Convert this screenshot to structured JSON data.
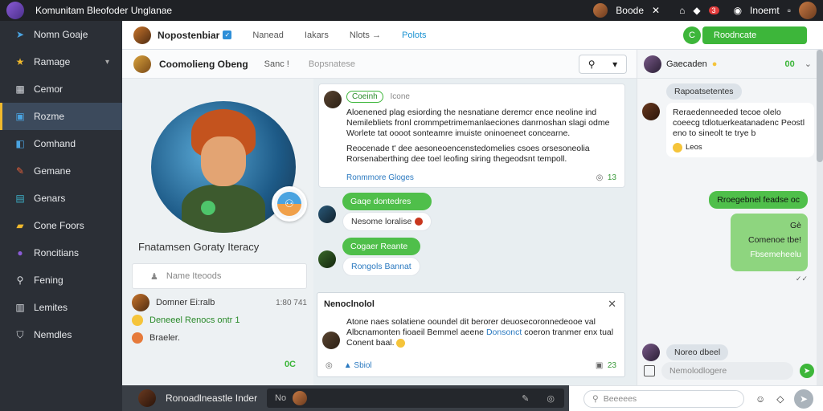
{
  "titlebar": {
    "title": "Komunitam Bleofoder Unglanae",
    "user_name": "Boode",
    "notif_count": "3",
    "account": "Inoemt"
  },
  "sidebar": {
    "items": [
      {
        "label": "Nomn Goaje",
        "icon": "book-icon",
        "color": "#4aa3e0"
      },
      {
        "label": "Ramage",
        "icon": "star-icon",
        "color": "#f0b92d",
        "expandable": true
      },
      {
        "label": "Cemor",
        "icon": "grid-icon",
        "color": "#d8dbe0"
      },
      {
        "label": "Rozme",
        "icon": "square-icon",
        "color": "#4aa3e0",
        "active": true
      },
      {
        "label": "Comhand",
        "icon": "chat-icon",
        "color": "#4aa3e0"
      },
      {
        "label": "Gemane",
        "icon": "pencil-icon",
        "color": "#e8603a"
      },
      {
        "label": "Genars",
        "icon": "image-icon",
        "color": "#3cb0c8"
      },
      {
        "label": "Cone Foors",
        "icon": "folder-icon",
        "color": "#f0b92d"
      },
      {
        "label": "Roncitians",
        "icon": "circle-icon",
        "color": "#8a5bd6"
      },
      {
        "label": "Fening",
        "icon": "lock-icon",
        "color": "#d8dbe0"
      },
      {
        "label": "Lemites",
        "icon": "calendar-icon",
        "color": "#d8dbe0"
      },
      {
        "label": "Nemdles",
        "icon": "shield-icon",
        "color": "#d8dbe0"
      }
    ]
  },
  "topnav": {
    "title": "Nopostenbiar",
    "tabs": [
      "Nanead",
      "Iakars",
      "Nlots →",
      "Polots"
    ],
    "active_tab": 3,
    "green_button": "Roodncate",
    "green_circle": "C"
  },
  "subheader": {
    "name": "Coomolieng Obeng",
    "item1": "Sanc !",
    "item2": "Bopsnatese"
  },
  "profile": {
    "name": "Fnatamsen Goraty Iteracy",
    "search_placeholder": "Name Iteoods",
    "comment_author": "Domner Ei:ralb",
    "comment_time": "1:80 741",
    "comment_line1": "Deneeel Renocs ontr 1",
    "comment_line2": "Braeler.",
    "comment_count": "0C"
  },
  "post": {
    "header": "Coeinh",
    "header_meta": "Icone",
    "para1": "Aloenened plag esiording the nesnatiane deremcr ence neoline ind Nemilebliets fronl crommpetrimemanlaeciones danrnoshan slagi odme Worlete tat oooot sonteamre imuiste oninoeneet concearne.",
    "para2": "Reocenade t' dee aesoneoencenstedomelies csoes orsesoneolia Rorsenaberthing dee toel leofing siring thegeodsnt tempoll.",
    "footer_link": "Ronmmore Gloges",
    "footer_count": "13"
  },
  "chat1": {
    "green": "Gaqe dontedres",
    "white": "Nesome loralise"
  },
  "chat2": {
    "green": "Cogaer Reante",
    "white": "Rongols Bannat"
  },
  "notice": {
    "title": "Nenoclnolol",
    "text_before": "Atone naes solatiene ooundel dit berorer deuosecoronnedeooe val Albcnamonten fioaeil Bemmel aeene ",
    "link": "Donsonct",
    "text_after": " coeron tranmer enx tual Conent baal.",
    "footer_label": "Sbiol",
    "footer_count": "23"
  },
  "bottombar": {
    "name": "Ronoadlneastle Inder",
    "input_placeholder": "No"
  },
  "rightpanel": {
    "header_name": "Gaecaden",
    "header_count": "00",
    "pill": "Rapoatsetentes",
    "msg_text": "Reraedenneeded tecoe olelo coeecg tdlotuerkeatanadenc Peostl eno to sineolt te trye b",
    "msg_small": "Leos",
    "out1": "Rroegebnel feadse oc",
    "out2_lines": [
      "Gè",
      "Comenoe tbe!",
      "Fbsemeheelu"
    ],
    "ticks": "✓✓",
    "in_msg": "Noreo dbeel",
    "input_placeholder": "Nemolodlogere"
  },
  "rb_bottom": {
    "search_placeholder": "Beeeees"
  }
}
